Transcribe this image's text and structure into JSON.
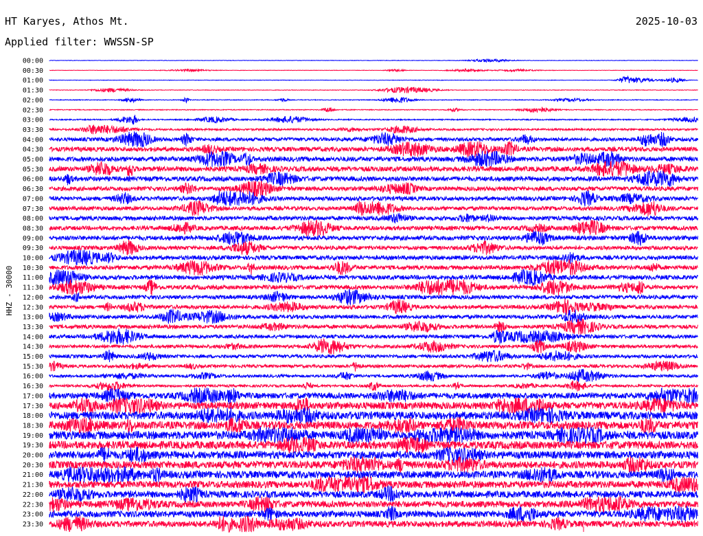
{
  "header": {
    "station": "HT Karyes, Athos Mt.",
    "date": "2025-10-03",
    "filter": "Applied filter: WWSSN-SP"
  },
  "chart_data": {
    "type": "line",
    "title": "HT Karyes, Athos Mt.",
    "ylabel": "HHZ - 30000",
    "line_labels": [
      "00:00",
      "00:30",
      "01:00",
      "01:30",
      "02:00",
      "02:30",
      "03:00",
      "03:30",
      "04:00",
      "04:30",
      "05:00",
      "05:30",
      "06:00",
      "06:30",
      "07:00",
      "07:30",
      "08:00",
      "08:30",
      "09:00",
      "09:30",
      "10:00",
      "10:30",
      "11:00",
      "11:30",
      "12:00",
      "12:30",
      "13:00",
      "13:30",
      "14:00",
      "14:30",
      "15:00",
      "15:30",
      "16:00",
      "16:30",
      "17:00",
      "17:30",
      "18:00",
      "18:30",
      "19:00",
      "19:30",
      "20:00",
      "20:30",
      "21:00",
      "21:30",
      "22:00",
      "22:30",
      "23:00",
      "23:30"
    ],
    "series_colors": [
      "#0000ff",
      "#ff0040"
    ],
    "noise_level": [
      0.3,
      0.3,
      0.3,
      0.4,
      0.5,
      0.6,
      0.8,
      1.4,
      2.6,
      3.2,
      3.4,
      3.6,
      3.4,
      3.0,
      3.0,
      2.8,
      3.0,
      3.0,
      3.2,
      2.8,
      3.0,
      3.0,
      3.2,
      3.0,
      2.8,
      2.8,
      2.8,
      2.8,
      2.6,
      2.4,
      2.4,
      2.2,
      2.0,
      1.8,
      4.2,
      5.0,
      5.6,
      5.6,
      5.8,
      5.6,
      5.4,
      5.2,
      5.2,
      5.0,
      4.8,
      4.6,
      4.6,
      4.4
    ]
  }
}
